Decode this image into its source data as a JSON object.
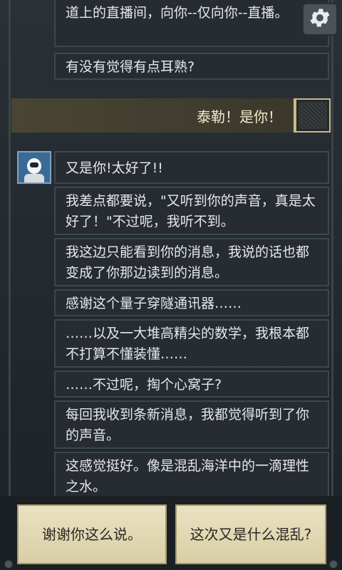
{
  "settings": {
    "icon": "gear-icon"
  },
  "conversation": {
    "previous_messages": [
      "道上的直播间，向你--仅向你--直播。",
      "有没有觉得有点耳熟?"
    ],
    "player_reply": "泰勒！是你！",
    "taylor_messages": [
      "又是你!太好了!!",
      "我差点都要说，\"又听到你的声音，真是太好了！\"不过呢，我听不到。",
      "我这边只能看到你的消息，我说的话也都变成了你那边读到的消息。",
      "感谢这个量子穿隧通讯器……",
      "……以及一大堆高精尖的数学，我根本都不打算不懂装懂……",
      "……不过呢，掏个心窝子?",
      "每回我收到条新消息，我都觉得听到了你的声音。",
      "这感觉挺好。像是混乱海洋中的一滴理性之水。"
    ]
  },
  "choices": [
    "谢谢你这么说。",
    "这次又是什么混乱?"
  ],
  "colors": {
    "background": "#1f2529",
    "bubble": "#262c31",
    "choice": "#e2d9b4",
    "player_bar": "#45402f"
  }
}
